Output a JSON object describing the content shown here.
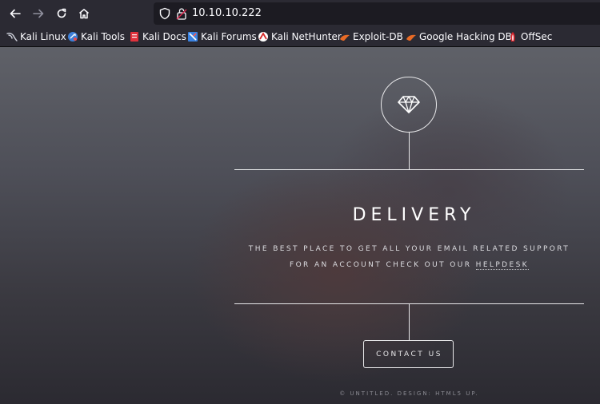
{
  "browser": {
    "url": "10.10.10.222",
    "bookmarks": [
      {
        "label": "Kali Linux",
        "icon": "kali-dragon-icon"
      },
      {
        "label": "Kali Tools",
        "icon": "kali-tools-icon"
      },
      {
        "label": "Kali Docs",
        "icon": "kali-docs-icon"
      },
      {
        "label": "Kali Forums",
        "icon": "kali-forums-icon"
      },
      {
        "label": "Kali NetHunter",
        "icon": "nethunter-icon"
      },
      {
        "label": "Exploit-DB",
        "icon": "exploit-db-icon"
      },
      {
        "label": "Google Hacking DB",
        "icon": "ghdb-icon"
      },
      {
        "label": "OffSec",
        "icon": "offsec-icon"
      }
    ]
  },
  "page": {
    "title": "DELIVERY",
    "tagline_line1": "THE BEST PLACE TO GET ALL YOUR EMAIL RELATED SUPPORT",
    "tagline_line2_prefix": "FOR AN ACCOUNT CHECK OUT OUR ",
    "helpdesk_link": "HELPDESK",
    "contact_button": "CONTACT US",
    "footer": "© UNTITLED. DESIGN: HTML5 UP.",
    "logo_icon": "diamond-icon"
  },
  "colors": {
    "toolbar": "#2b2a33",
    "url_field": "#1c1b22",
    "foreground": "#e8e8ea"
  }
}
